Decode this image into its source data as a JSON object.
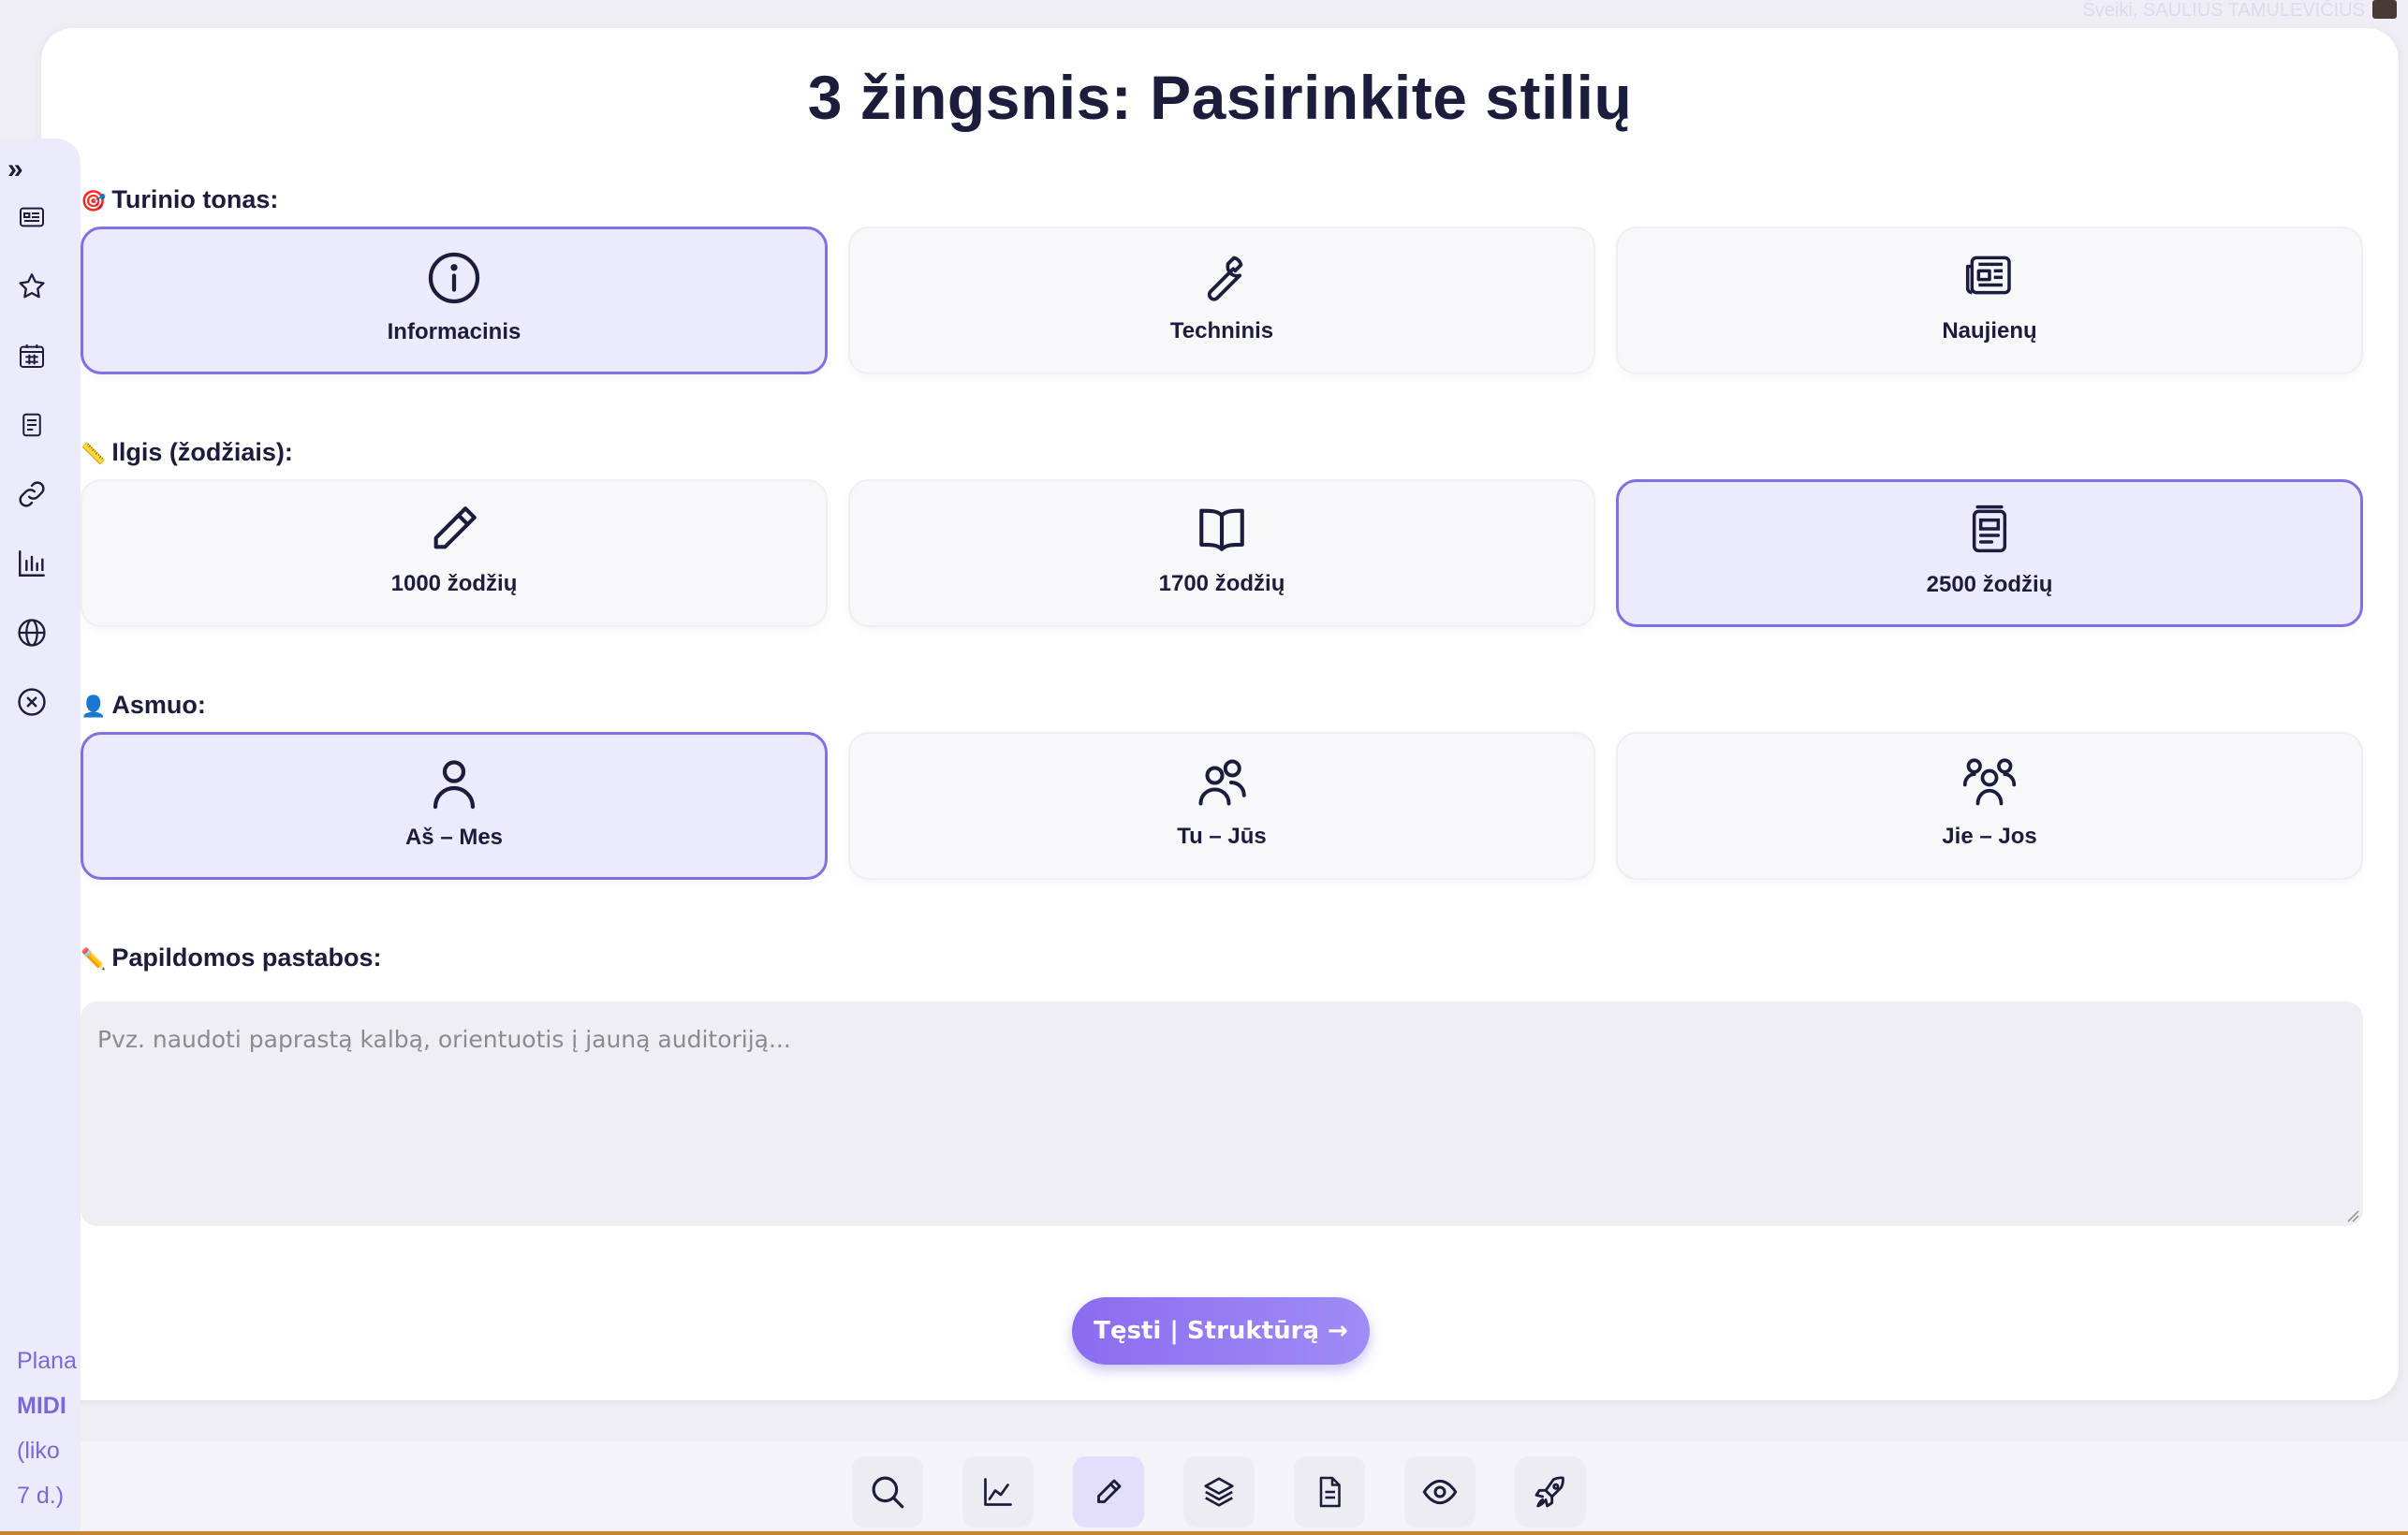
{
  "header": {
    "greeting": "Sveiki, SAULIUS TAMULEVIČIUS"
  },
  "page": {
    "title": "3 žingsnis: Pasirinkite stilių"
  },
  "sections": {
    "tone": {
      "label": "Turinio tonas:",
      "emoji": "🎯",
      "options": [
        {
          "label": "Informacinis",
          "icon": "info-icon",
          "selected": true
        },
        {
          "label": "Techninis",
          "icon": "wrench-icon",
          "selected": false
        },
        {
          "label": "Naujienų",
          "icon": "newspaper-icon",
          "selected": false
        }
      ]
    },
    "length": {
      "label": "Ilgis (žodžiais):",
      "emoji": "📏",
      "options": [
        {
          "label": "1000 žodžių",
          "icon": "pencil-icon",
          "selected": false
        },
        {
          "label": "1700 žodžių",
          "icon": "book-icon",
          "selected": false
        },
        {
          "label": "2500 žodžių",
          "icon": "document-stack-icon",
          "selected": true
        }
      ]
    },
    "person": {
      "label": "Asmuo:",
      "emoji": "👤",
      "options": [
        {
          "label": "Aš – Mes",
          "icon": "user-icon",
          "selected": true
        },
        {
          "label": "Tu – Jūs",
          "icon": "users-icon",
          "selected": false
        },
        {
          "label": "Jie – Jos",
          "icon": "group-icon",
          "selected": false
        }
      ]
    },
    "notes": {
      "label": "Papildomos pastabos:",
      "emoji": "✏️",
      "placeholder": "Pvz. naudoti paprastą kalbą, orientuotis į jauną auditoriją...",
      "value": ""
    }
  },
  "continue_button": {
    "label": "Tęsti | Struktūrą →"
  },
  "sidebar": {
    "toggle": "»",
    "icons": [
      "article-icon",
      "star-icon",
      "calendar-icon",
      "notes-icon",
      "link-icon",
      "bar-chart-icon",
      "globe-icon",
      "close-circle-icon"
    ],
    "plan": {
      "label": "Plana",
      "tier": "MIDI",
      "remaining_1": "(liko",
      "remaining_2": "7 d.)"
    }
  },
  "bottom_nav": {
    "items": [
      "search-icon",
      "line-chart-icon",
      "pencil-icon",
      "layers-icon",
      "file-icon",
      "eye-icon",
      "rocket-icon"
    ],
    "active": "pencil-icon"
  },
  "colors": {
    "accent": "#8070e4",
    "selected_bg": "#ecebfd",
    "button_gradient_start": "#8b6cf0",
    "title": "#1c1c3c"
  }
}
